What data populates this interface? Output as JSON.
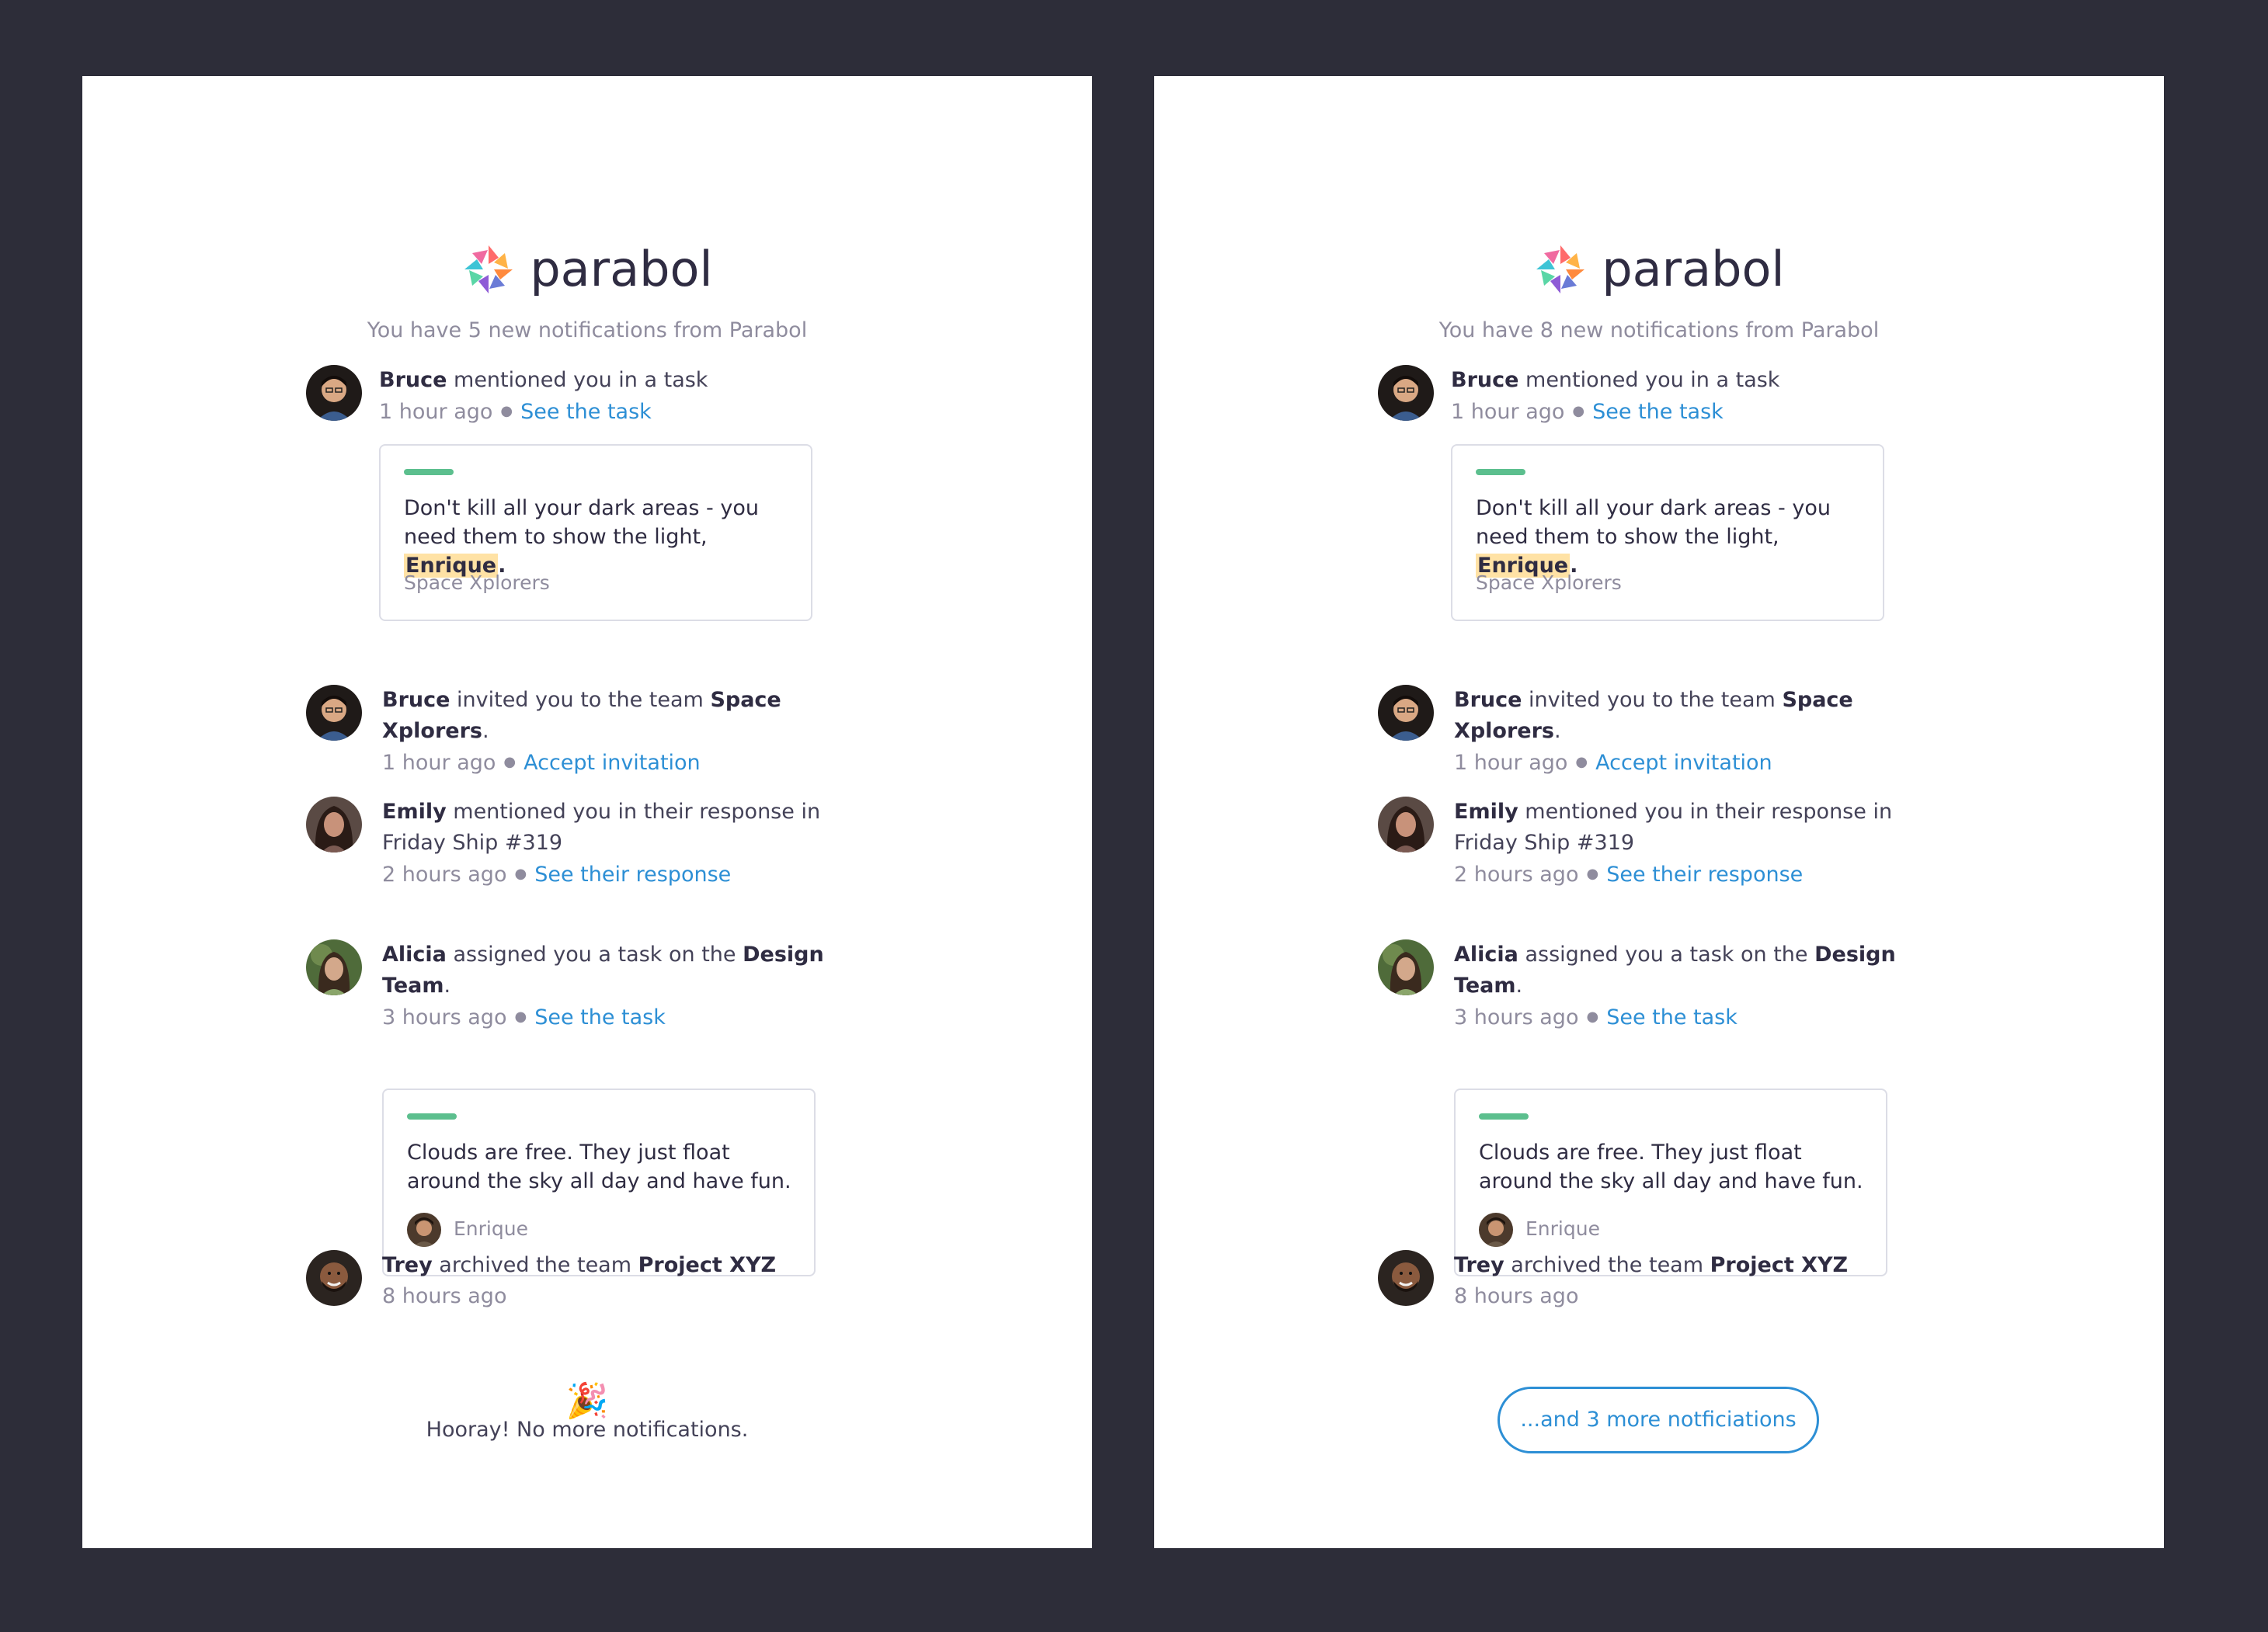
{
  "brand": {
    "name": "parabol",
    "accent": "#2d8fd5",
    "highlight": "#ffe2a5",
    "task_bar": "#5cbf8e",
    "background": "#2d2d39"
  },
  "panels": [
    {
      "subtitle": "You have 5 new notifications from Parabol",
      "footer": {
        "type": "hooray",
        "icon": "party-popper-icon",
        "emoji": "🎉",
        "text": "Hooray! No more notifications."
      }
    },
    {
      "subtitle": "You have 8 new notifications from Parabol",
      "footer": {
        "type": "more-button",
        "text": "...and 3 more notficiations"
      }
    }
  ],
  "notifications": [
    {
      "actor": "Bruce",
      "text_before": " mentioned you in a task",
      "time": "1 hour ago",
      "action": "See the task",
      "card": {
        "text": "Don't kill all your dark areas - you need them to show the light, ",
        "mention": "Enrique",
        "mention_suffix": ".",
        "footer": "Space Xplorers"
      }
    },
    {
      "actor": "Bruce",
      "text_before": " invited you to the team ",
      "bold": "Space Xplorers",
      "text_after": ".",
      "time": "1 hour ago",
      "action": "Accept invitation"
    },
    {
      "actor": "Emily",
      "text_before": " mentioned you in their response in Friday Ship #319",
      "time": "2 hours ago",
      "action": "See their response"
    },
    {
      "actor": "Alicia",
      "text_before": " assigned you a task on the ",
      "bold": "Design Team",
      "text_after": ".",
      "time": "3 hours ago",
      "action": "See the task",
      "card": {
        "text": "Clouds are free. They just float around the sky all day and have fun.",
        "footer": "Enrique"
      }
    },
    {
      "actor": "Trey",
      "text_before": " archived the team ",
      "bold": "Project XYZ",
      "text_after": "",
      "time": "8 hours ago"
    }
  ]
}
